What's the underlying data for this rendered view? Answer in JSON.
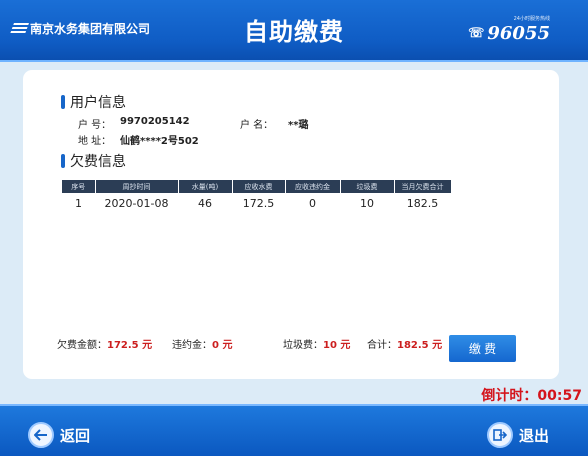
{
  "header": {
    "company": "南京水务集团有限公司",
    "title": "自助缴费",
    "hotline_small": "24小时服务热线",
    "hotline": "96055"
  },
  "user_info": {
    "section_title": "用户信息",
    "account_label": "户  号：",
    "account_value": "9970205142",
    "name_label": "户  名：",
    "name_value": "**璐",
    "address_label": "地  址：",
    "address_value": "仙鹤****2号502"
  },
  "arrears": {
    "section_title": "欠费信息",
    "columns": [
      "序号",
      "周抄时间",
      "水量(吨)",
      "应收水费",
      "应收违约金",
      "垃圾费",
      "当月欠费合计"
    ],
    "rows": [
      [
        "1",
        "2020-01-08",
        "46",
        "172.5",
        "0",
        "10",
        "182.5"
      ]
    ]
  },
  "summary": {
    "arrears_label": "欠费金额：",
    "arrears_value": "172.5 元",
    "penalty_label": "违约金：",
    "penalty_value": "0 元",
    "garbage_label": "垃圾费：",
    "garbage_value": "10 元",
    "total_label": "合计：",
    "total_value": "182.5 元"
  },
  "pay_button_label": "缴 费",
  "countdown_label": "倒计时：",
  "countdown_value": "00:57",
  "footer": {
    "back_label": "返回",
    "exit_label": "退出"
  },
  "icons": {
    "back": "back-arrow-icon",
    "exit": "exit-icon",
    "phone": "phone-icon"
  },
  "colors": {
    "header_blue": "#1a6fd6",
    "accent_red": "#d4141c",
    "table_header": "#2b3d55"
  }
}
